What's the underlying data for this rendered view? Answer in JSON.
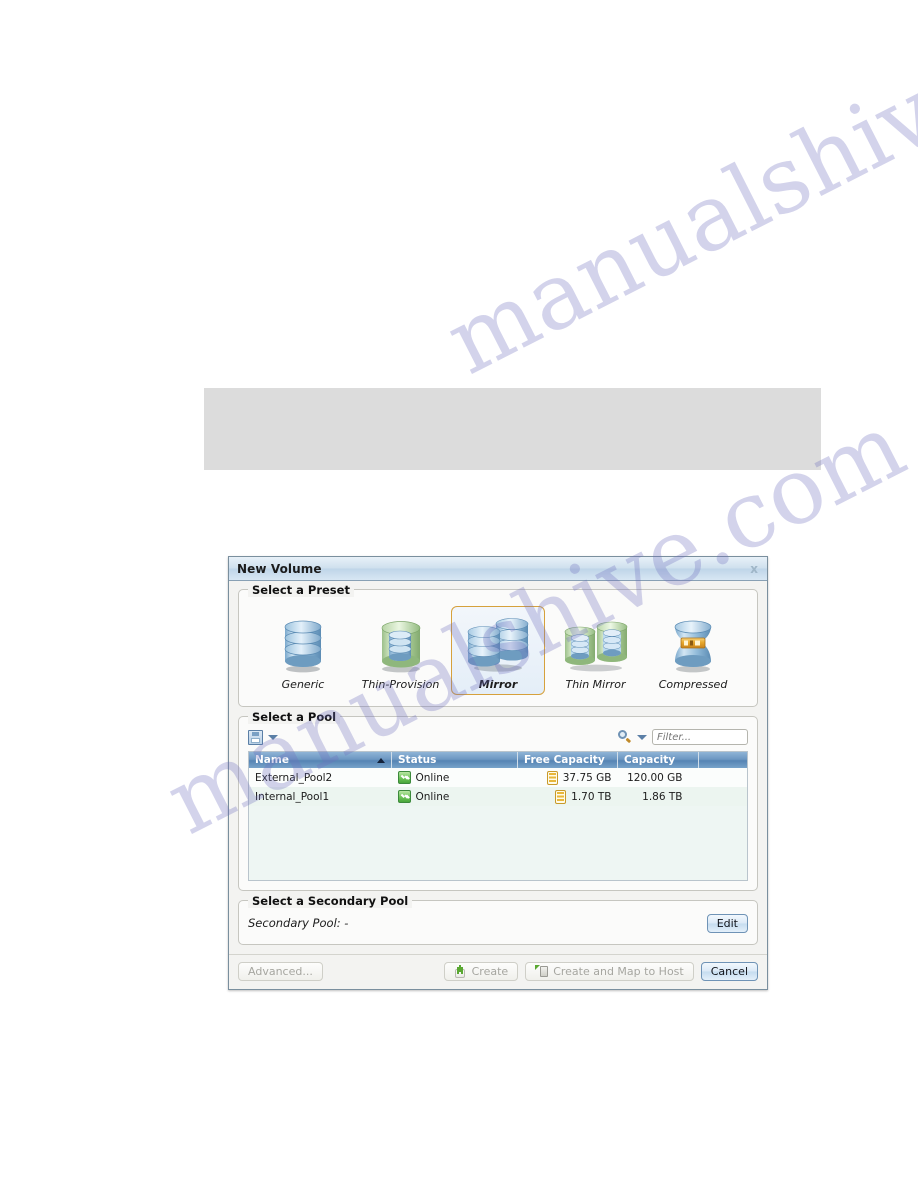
{
  "dialog": {
    "title": "New Volume",
    "close_label": "x",
    "presets": {
      "legend": "Select a Preset",
      "items": [
        {
          "label": "Generic",
          "icon": "database-single-blue-icon",
          "selected": false
        },
        {
          "label": "Thin-Provision",
          "icon": "database-thin-green-icon",
          "selected": false
        },
        {
          "label": "Mirror",
          "icon": "database-mirror-blue-icon",
          "selected": true
        },
        {
          "label": "Thin Mirror",
          "icon": "database-thin-mirror-icon",
          "selected": false
        },
        {
          "label": "Compressed",
          "icon": "database-compressed-icon",
          "selected": false
        }
      ]
    },
    "pool": {
      "legend": "Select a Pool",
      "toolbar": {
        "save_icon": "save-icon",
        "save_caret_icon": "chevron-down-icon",
        "search_icon": "search-icon",
        "search_caret_icon": "chevron-down-icon",
        "filter_placeholder": "Filter...",
        "filter_value": ""
      },
      "columns": [
        {
          "label": "Name",
          "sorted": "asc"
        },
        {
          "label": "Status",
          "sorted": ""
        },
        {
          "label": "Free Capacity",
          "sorted": ""
        },
        {
          "label": "Capacity",
          "sorted": ""
        },
        {
          "label": "",
          "sorted": ""
        }
      ],
      "rows": [
        {
          "name": "External_Pool2",
          "status": "Online",
          "free_capacity": "37.75 GB",
          "capacity": "120.00 GB"
        },
        {
          "name": "Internal_Pool1",
          "status": "Online",
          "free_capacity": "1.70 TB",
          "capacity": "1.86 TB"
        }
      ]
    },
    "secondary": {
      "legend": "Select a Secondary Pool",
      "value_text": "Secondary Pool: -",
      "edit_label": "Edit"
    },
    "footer": {
      "advanced_label": "Advanced...",
      "create_label": "Create",
      "create_map_label": "Create and Map to Host",
      "cancel_label": "Cancel"
    }
  },
  "watermark": {
    "line_a": "manualshive.com",
    "line_b": "manualshive.com"
  },
  "colors": {
    "accent_blue": "#6d97c2",
    "selected_border": "#d6a13c",
    "status_green": "#2c7a2c",
    "band_grey": "#dcdcdc"
  }
}
